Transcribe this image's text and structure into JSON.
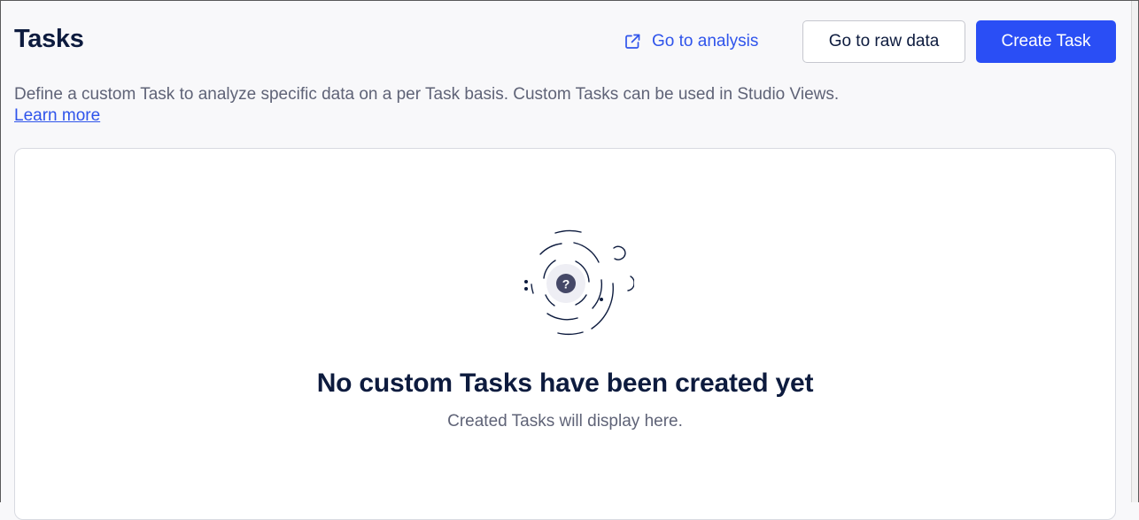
{
  "header": {
    "title": "Tasks",
    "go_to_analysis": "Go to analysis",
    "go_to_analysis_icon": "external-link-icon",
    "go_to_raw_data": "Go to raw data",
    "create_task": "Create Task"
  },
  "description": {
    "text": "Define a custom Task to analyze specific data on a per Task basis. Custom Tasks can be used in Studio Views.",
    "learn_more": "Learn more"
  },
  "empty_state": {
    "icon": "question-orbit-icon",
    "title": "No custom Tasks have been created yet",
    "subtitle": "Created Tasks will display here."
  },
  "colors": {
    "accent": "#2a4ef5",
    "link": "#2f54eb",
    "heading": "#0d1b3e",
    "muted_text": "#5f6377",
    "background": "#f8f8fa"
  }
}
